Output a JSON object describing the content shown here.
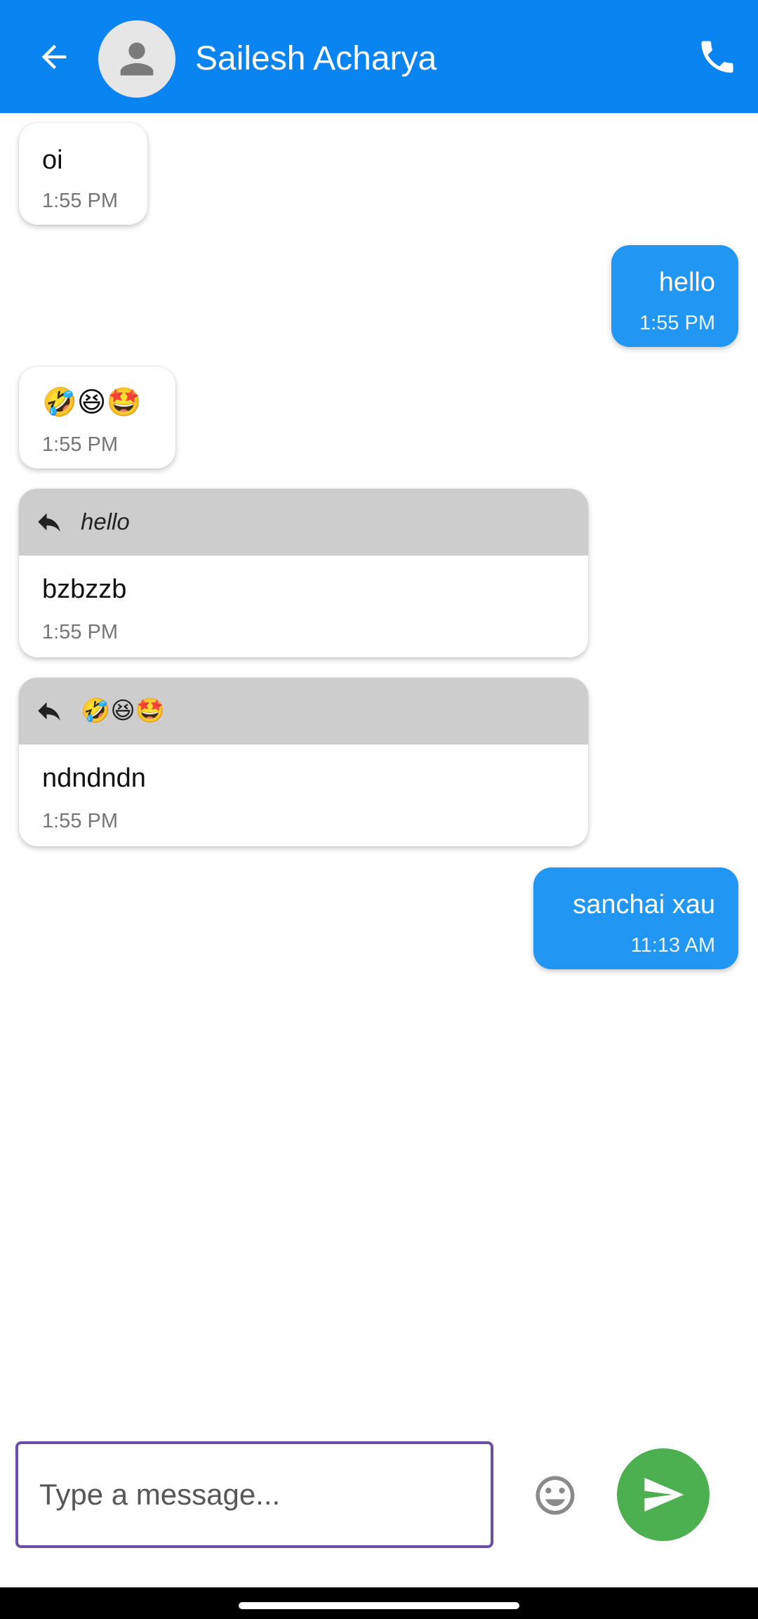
{
  "header": {
    "contact_name": "Sailesh Acharya",
    "back_icon": "arrow-back-icon",
    "avatar_icon": "person-icon",
    "call_icon": "phone-icon",
    "color": "#0a84f0"
  },
  "messages": [
    {
      "direction": "incoming",
      "text": "oi",
      "time": "1:55 PM"
    },
    {
      "direction": "outgoing",
      "text": "hello",
      "time": "1:55 PM"
    },
    {
      "direction": "incoming",
      "text": "🤣😆🤩",
      "time": "1:55 PM"
    },
    {
      "direction": "incoming",
      "reply_to": "hello",
      "text": "bzbzzb",
      "time": "1:55 PM"
    },
    {
      "direction": "incoming",
      "reply_to": "🤣😆🤩",
      "text": "ndndndn",
      "time": "1:55 PM"
    },
    {
      "direction": "outgoing",
      "text": "sanchai xau",
      "time": "11:13 AM"
    }
  ],
  "composer": {
    "placeholder": "Type a message...",
    "value": "",
    "emoji_icon": "smiley-icon",
    "send_icon": "send-icon",
    "send_color": "#4caf50"
  },
  "colors": {
    "outgoing_bubble": "#2196f3",
    "reply_header": "#cdcdcd",
    "input_border": "#6b4ea8"
  }
}
